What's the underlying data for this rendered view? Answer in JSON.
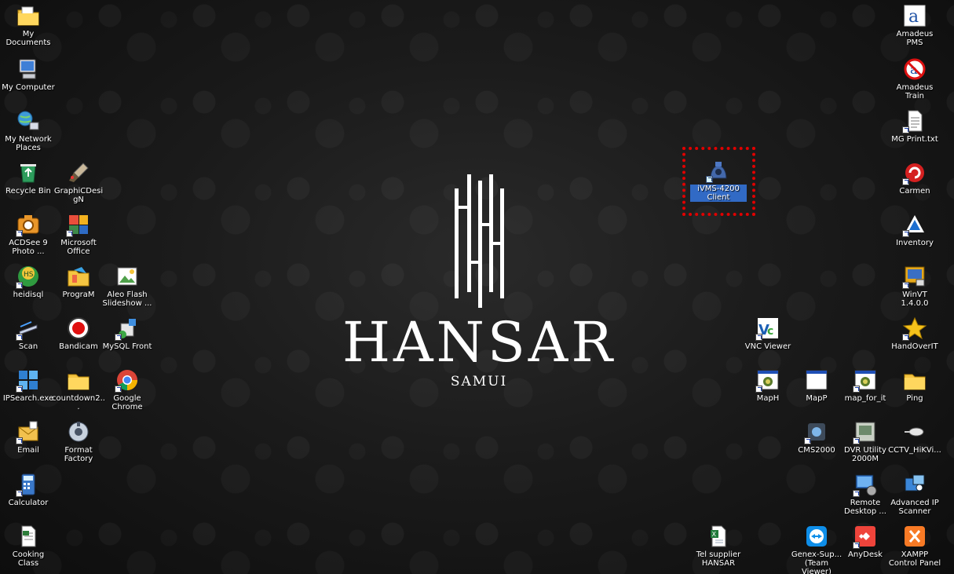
{
  "wallpaper": {
    "brand": "HANSAR",
    "location": "SAMUI"
  },
  "highlight": {
    "color": "#e00000",
    "target": "VMS-4200 Client"
  },
  "icons": [
    {
      "id": "my-documents",
      "label": "My Documents",
      "icon": "folder-documents-icon",
      "shortcut": false
    },
    {
      "id": "my-computer",
      "label": "My Computer",
      "icon": "computer-icon",
      "shortcut": false
    },
    {
      "id": "my-network-places",
      "label": "My Network Places",
      "icon": "network-icon",
      "shortcut": false
    },
    {
      "id": "recycle-bin",
      "label": "Recycle Bin",
      "icon": "recycle-bin-icon",
      "shortcut": false
    },
    {
      "id": "graphicdesign",
      "label": "GraphiCDesigN",
      "icon": "paint-brush-icon",
      "shortcut": false
    },
    {
      "id": "acdsee",
      "label": "ACDSee 9 Photo ...",
      "icon": "camera-icon",
      "shortcut": true
    },
    {
      "id": "ms-office",
      "label": "Microsoft Office",
      "icon": "office-icon",
      "shortcut": true
    },
    {
      "id": "heidisql",
      "label": "heidisql",
      "icon": "heidisql-icon",
      "shortcut": true
    },
    {
      "id": "program",
      "label": "PrograM",
      "icon": "program-folder-icon",
      "shortcut": false
    },
    {
      "id": "aleo-flash",
      "label": "Aleo Flash Slideshow ...",
      "icon": "slideshow-icon",
      "shortcut": false
    },
    {
      "id": "scan",
      "label": "Scan",
      "icon": "scanner-icon",
      "shortcut": true
    },
    {
      "id": "bandicam",
      "label": "Bandicam",
      "icon": "record-icon",
      "shortcut": false
    },
    {
      "id": "mysql-front",
      "label": "MySQL Front",
      "icon": "database-icon",
      "shortcut": true
    },
    {
      "id": "ipsearch",
      "label": "IPSearch.exe",
      "icon": "ipsearch-icon",
      "shortcut": true
    },
    {
      "id": "countdown",
      "label": "countdown2...",
      "icon": "folder-icon",
      "shortcut": false
    },
    {
      "id": "google-chrome",
      "label": "Google Chrome",
      "icon": "chrome-icon",
      "shortcut": true
    },
    {
      "id": "email",
      "label": "Email",
      "icon": "email-icon",
      "shortcut": true
    },
    {
      "id": "format-factory",
      "label": "Format Factory",
      "icon": "format-factory-icon",
      "shortcut": false
    },
    {
      "id": "calculator",
      "label": "Calculator",
      "icon": "calculator-icon",
      "shortcut": true
    },
    {
      "id": "cooking-class",
      "label": "Cooking Class",
      "icon": "document-icon",
      "shortcut": false
    },
    {
      "id": "vms-4200",
      "label": "iVMS-4200 Client",
      "icon": "camera-client-icon",
      "shortcut": true,
      "selected": true
    },
    {
      "id": "vnc-viewer",
      "label": "VNC Viewer",
      "icon": "vnc-icon",
      "shortcut": true
    },
    {
      "id": "maph",
      "label": "MapH",
      "icon": "window-app-icon",
      "shortcut": true
    },
    {
      "id": "mapp",
      "label": "MapP",
      "icon": "blank-window-icon",
      "shortcut": false
    },
    {
      "id": "map-for-it",
      "label": "map_for_it",
      "icon": "window-app-icon",
      "shortcut": true
    },
    {
      "id": "ping",
      "label": "Ping",
      "icon": "folder-icon",
      "shortcut": false
    },
    {
      "id": "cms2000",
      "label": "CMS2000",
      "icon": "cms-icon",
      "shortcut": true
    },
    {
      "id": "dvr-utility",
      "label": "DVR Utility 2000M",
      "icon": "dvr-icon",
      "shortcut": true
    },
    {
      "id": "cctv-hikvi",
      "label": "CCTV_HiKVi...",
      "icon": "mouse-icon",
      "shortcut": false
    },
    {
      "id": "remote-desktop",
      "label": "Remote Desktop ...",
      "icon": "remote-desktop-icon",
      "shortcut": true
    },
    {
      "id": "advanced-ip",
      "label": "Advanced IP Scanner",
      "icon": "ip-scanner-icon",
      "shortcut": false
    },
    {
      "id": "tel-supplier",
      "label": "Tel supplier HANSAR",
      "icon": "excel-icon",
      "shortcut": false
    },
    {
      "id": "genex",
      "label": "Genex-Sup... (Team Viewer)",
      "icon": "teamviewer-icon",
      "shortcut": false
    },
    {
      "id": "anydesk",
      "label": "AnyDesk",
      "icon": "anydesk-icon",
      "shortcut": true
    },
    {
      "id": "xampp",
      "label": "XAMPP Control Panel",
      "icon": "xampp-icon",
      "shortcut": false
    },
    {
      "id": "amadeus-pms",
      "label": "Amadeus PMS",
      "icon": "amadeus-icon",
      "shortcut": false
    },
    {
      "id": "amadeus-train",
      "label": "Amadeus Train",
      "icon": "amadeus-train-icon",
      "shortcut": false
    },
    {
      "id": "mg-print",
      "label": "MG Print.txt",
      "icon": "text-file-icon",
      "shortcut": true
    },
    {
      "id": "carmen",
      "label": "Carmen",
      "icon": "carmen-icon",
      "shortcut": true
    },
    {
      "id": "inventory",
      "label": "Inventory",
      "icon": "inventory-icon",
      "shortcut": true
    },
    {
      "id": "winvt",
      "label": "WinVT 1.4.0.0",
      "icon": "winvt-icon",
      "shortcut": true
    },
    {
      "id": "handoverit",
      "label": "HandOverIT",
      "icon": "star-icon",
      "shortcut": true
    }
  ]
}
